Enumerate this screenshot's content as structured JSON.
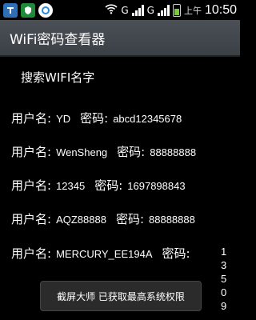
{
  "status_bar": {
    "ampm": "上午",
    "time": "10:50",
    "network_left": "G",
    "network_right": "G"
  },
  "app": {
    "title": "WiFi密码查看器"
  },
  "search_label": "搜索WIFI名字",
  "rows": [
    {
      "user_label": "用户名:",
      "ssid": "YD",
      "pw_label": "密码:",
      "password": "abcd12345678"
    },
    {
      "user_label": "用户名:",
      "ssid": "WenSheng",
      "pw_label": "密码:",
      "password": "88888888"
    },
    {
      "user_label": "用户名:",
      "ssid": "12345",
      "pw_label": "密码:",
      "password": "1697898843"
    },
    {
      "user_label": "用户名:",
      "ssid": "AQZ88888",
      "pw_label": "密码:",
      "password": "88888888"
    },
    {
      "user_label": "用户名:",
      "ssid": "MERCURY_EE194A",
      "pw_label": "密码:",
      "password": "13509"
    }
  ],
  "toast": "截屏大师 已获取最高系统权限"
}
